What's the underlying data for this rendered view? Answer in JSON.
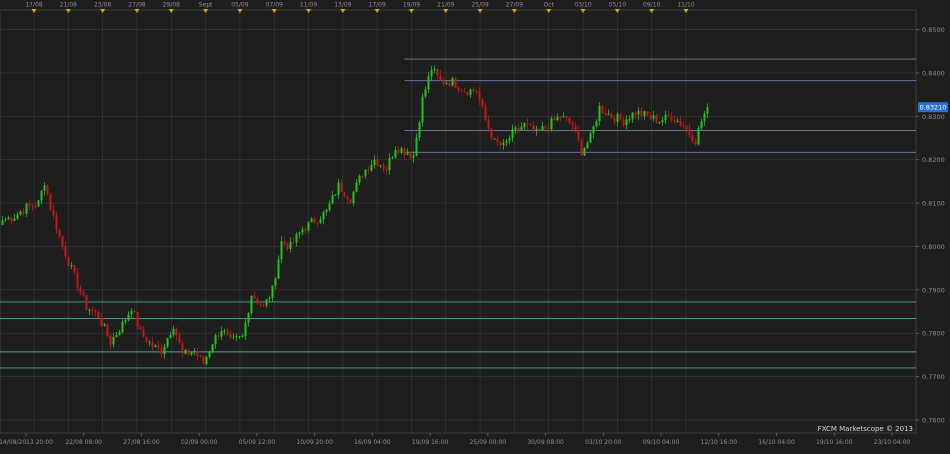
{
  "watermark": "FXCM Marketscope © 2013",
  "colors": {
    "background": "#1e1e1e",
    "grid": "#3a3a3a",
    "bull": "#22c21f",
    "bear": "#c41616",
    "resistance_lines": "#6f7fb3",
    "support_lines": "#4aa79e",
    "axis_text": "#8f8f8f",
    "event_marker": "#d9a21b",
    "price_tag": "#2a6fd0"
  },
  "chart_data": {
    "type": "candlestick",
    "instrument_price_label": "0.83210",
    "last_price": 0.8321,
    "ylim": [
      0.757,
      0.8545
    ],
    "y_ticks": [
      "0.7600",
      "0.7700",
      "0.7800",
      "0.7900",
      "0.8000",
      "0.8100",
      "0.8200",
      "0.8300",
      "0.8400",
      "0.8500"
    ],
    "y_tick_values": [
      0.76,
      0.77,
      0.78,
      0.79,
      0.8,
      0.81,
      0.82,
      0.83,
      0.84,
      0.85
    ],
    "x_top_labels": [
      "17/08",
      "21/08",
      "23/08",
      "27/08",
      "29/08",
      "Sept",
      "05/09",
      "07/09",
      "11/09",
      "13/09",
      "17/09",
      "19/09",
      "21/09",
      "25/09",
      "27/09",
      "Oct",
      "03/10",
      "05/10",
      "09/10",
      "11/10"
    ],
    "x_bottom_labels": [
      "14/08/2013 20:00",
      "22/08 08:00",
      "27/08 16:00",
      "02/09 00:00",
      "05/09 12:00",
      "10/09 20:00",
      "16/09 04:00",
      "19/09 16:00",
      "25/09 00:00",
      "30/09 08:00",
      "03/10 20:00",
      "09/10 04:00",
      "12/10 16:00",
      "16/10 04:00",
      "19/10 16:00",
      "23/10 04:00"
    ],
    "horizontal_lines": [
      {
        "kind": "resistance",
        "value": 0.8432,
        "from_index": 134
      },
      {
        "kind": "resistance",
        "value": 0.8382,
        "from_index": 134
      },
      {
        "kind": "resistance",
        "value": 0.8267,
        "from_index": 134
      },
      {
        "kind": "resistance",
        "value": 0.8217,
        "from_index": 134
      },
      {
        "kind": "support",
        "value": 0.7872,
        "from_index": 0
      },
      {
        "kind": "support",
        "value": 0.7834,
        "from_index": 0
      },
      {
        "kind": "support",
        "value": 0.7757,
        "from_index": 0
      },
      {
        "kind": "support",
        "value": 0.772,
        "from_index": 0
      }
    ],
    "close_anchors": [
      [
        0,
        0.806
      ],
      [
        4,
        0.807
      ],
      [
        8,
        0.809
      ],
      [
        12,
        0.81
      ],
      [
        14,
        0.815
      ],
      [
        16,
        0.809
      ],
      [
        20,
        0.8
      ],
      [
        24,
        0.793
      ],
      [
        28,
        0.786
      ],
      [
        32,
        0.784
      ],
      [
        36,
        0.778
      ],
      [
        40,
        0.782
      ],
      [
        43,
        0.786
      ],
      [
        46,
        0.78
      ],
      [
        50,
        0.777
      ],
      [
        53,
        0.776
      ],
      [
        57,
        0.782
      ],
      [
        60,
        0.775
      ],
      [
        64,
        0.776
      ],
      [
        67,
        0.773
      ],
      [
        70,
        0.778
      ],
      [
        73,
        0.781
      ],
      [
        76,
        0.778
      ],
      [
        80,
        0.779
      ],
      [
        83,
        0.789
      ],
      [
        87,
        0.786
      ],
      [
        90,
        0.79
      ],
      [
        93,
        0.801
      ],
      [
        96,
        0.8
      ],
      [
        100,
        0.804
      ],
      [
        104,
        0.806
      ],
      [
        108,
        0.808
      ],
      [
        112,
        0.814
      ],
      [
        116,
        0.811
      ],
      [
        120,
        0.817
      ],
      [
        124,
        0.82
      ],
      [
        128,
        0.818
      ],
      [
        131,
        0.823
      ],
      [
        134,
        0.822
      ],
      [
        137,
        0.821
      ],
      [
        140,
        0.834
      ],
      [
        143,
        0.841
      ],
      [
        146,
        0.838
      ],
      [
        150,
        0.838
      ],
      [
        154,
        0.836
      ],
      [
        158,
        0.836
      ],
      [
        161,
        0.829
      ],
      [
        164,
        0.824
      ],
      [
        167,
        0.823
      ],
      [
        170,
        0.826
      ],
      [
        174,
        0.828
      ],
      [
        178,
        0.826
      ],
      [
        182,
        0.828
      ],
      [
        186,
        0.83
      ],
      [
        190,
        0.828
      ],
      [
        193,
        0.822
      ],
      [
        196,
        0.825
      ],
      [
        199,
        0.832
      ],
      [
        203,
        0.83
      ],
      [
        207,
        0.829
      ],
      [
        211,
        0.831
      ],
      [
        215,
        0.83
      ],
      [
        219,
        0.829
      ],
      [
        223,
        0.83
      ],
      [
        227,
        0.828
      ],
      [
        229,
        0.826
      ],
      [
        231,
        0.8245
      ],
      [
        233,
        0.829
      ],
      [
        235,
        0.8321
      ]
    ],
    "candle_count": 236
  }
}
